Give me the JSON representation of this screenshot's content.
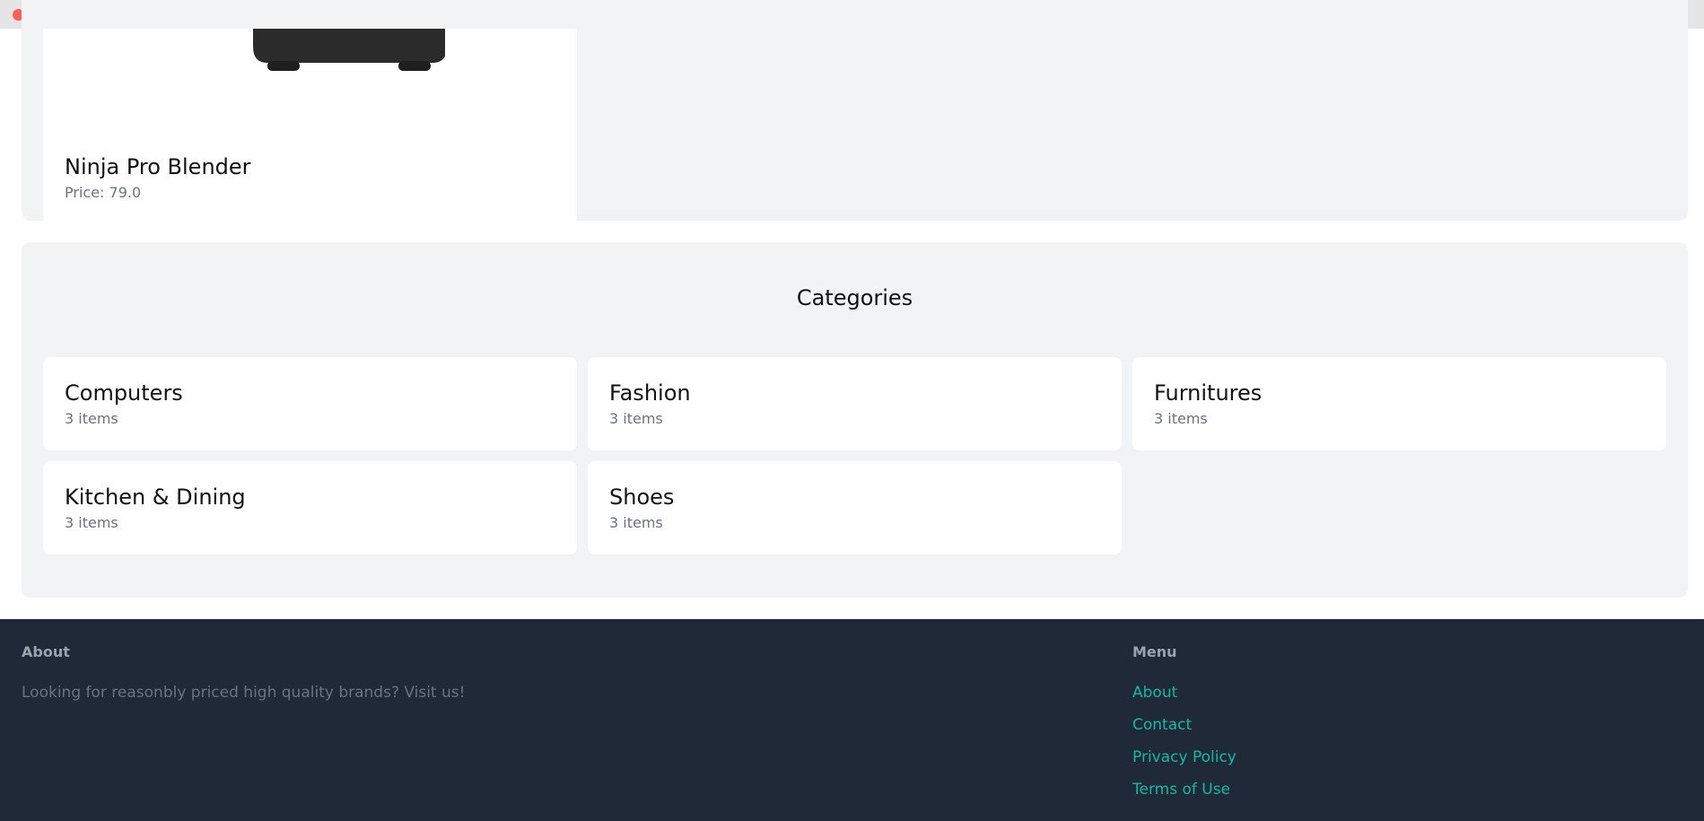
{
  "product": {
    "name": "Ninja Pro Blender",
    "price_text": "Price: 79.0"
  },
  "categories_section": {
    "title": "Categories",
    "items": [
      {
        "name": "Computers",
        "count": "3 items"
      },
      {
        "name": "Fashion",
        "count": "3 items"
      },
      {
        "name": "Furnitures",
        "count": "3 items"
      },
      {
        "name": "Kitchen & Dining",
        "count": "3 items"
      },
      {
        "name": "Shoes",
        "count": "3 items"
      }
    ]
  },
  "footer": {
    "about_heading": "About",
    "about_text": "Looking for reasonbly priced high quality brands? Visit us!",
    "menu_heading": "Menu",
    "menu_links": [
      "About",
      "Contact",
      "Privacy Policy",
      "Terms of Use"
    ]
  },
  "colors": {
    "link": "#14b8a6",
    "footer_bg": "#1f2937",
    "panel_bg": "#f2f3f5"
  }
}
